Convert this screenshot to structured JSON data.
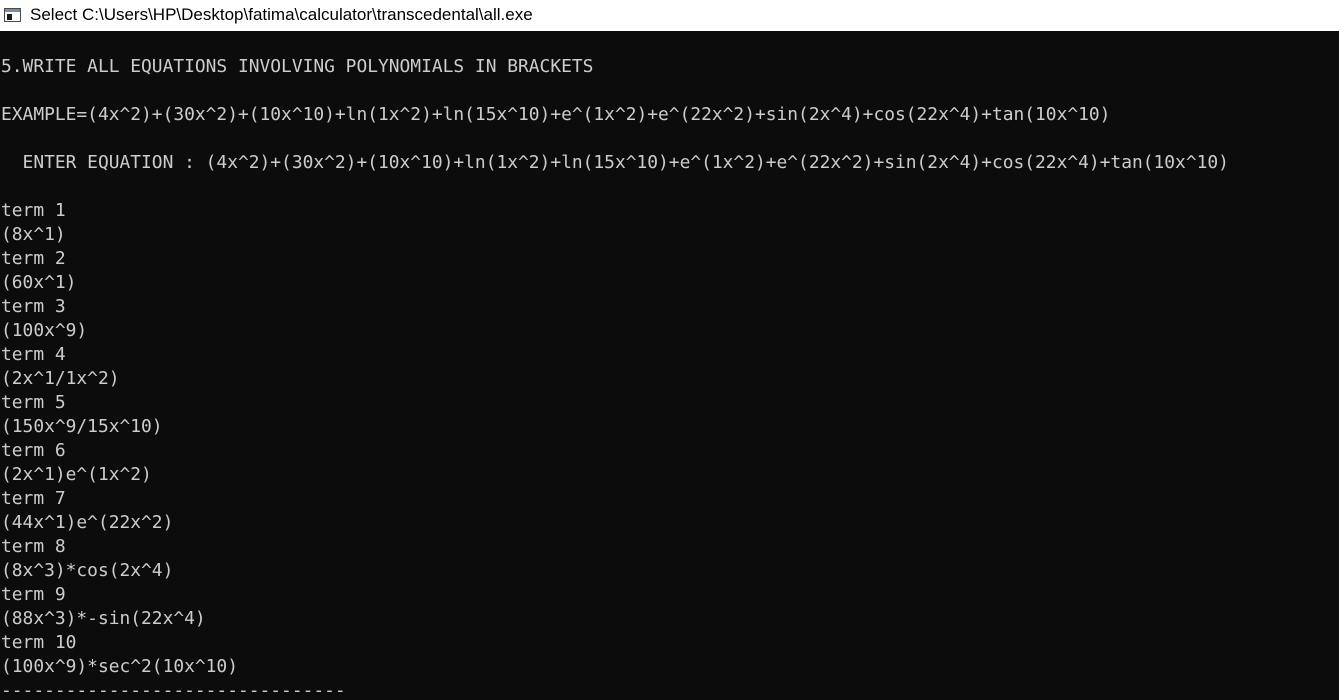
{
  "window": {
    "title": "Select C:\\Users\\HP\\Desktop\\fatima\\calculator\\transcedental\\all.exe",
    "icon": "console-app-icon"
  },
  "console": {
    "instruction": "5.WRITE ALL EQUATIONS INVOLVING POLYNOMIALS IN BRACKETS",
    "example": "EXAMPLE=(4x^2)+(30x^2)+(10x^10)+ln(1x^2)+ln(15x^10)+e^(1x^2)+e^(22x^2)+sin(2x^4)+cos(22x^4)+tan(10x^10)",
    "prompt": "  ENTER EQUATION : (4x^2)+(30x^2)+(10x^10)+ln(1x^2)+ln(15x^10)+e^(1x^2)+e^(22x^2)+sin(2x^4)+cos(22x^4)+tan(10x^10)",
    "terms": [
      {
        "label": "term 1",
        "value": "(8x^1)"
      },
      {
        "label": "term 2",
        "value": "(60x^1)"
      },
      {
        "label": "term 3",
        "value": "(100x^9)"
      },
      {
        "label": "term 4",
        "value": "(2x^1/1x^2)"
      },
      {
        "label": "term 5",
        "value": "(150x^9/15x^10)"
      },
      {
        "label": "term 6",
        "value": "(2x^1)e^(1x^2)"
      },
      {
        "label": "term 7",
        "value": "(44x^1)e^(22x^2)"
      },
      {
        "label": "term 8",
        "value": "(8x^3)*cos(2x^4)"
      },
      {
        "label": "term 9",
        "value": "(88x^3)*-sin(22x^4)"
      },
      {
        "label": "term 10",
        "value": "(100x^9)*sec^2(10x^10)"
      }
    ],
    "separator": "--------------------------------"
  },
  "colors": {
    "console_background": "#0c0c0c",
    "console_text": "#cccccc",
    "titlebar_background": "#ffffff",
    "titlebar_text": "#000000"
  }
}
